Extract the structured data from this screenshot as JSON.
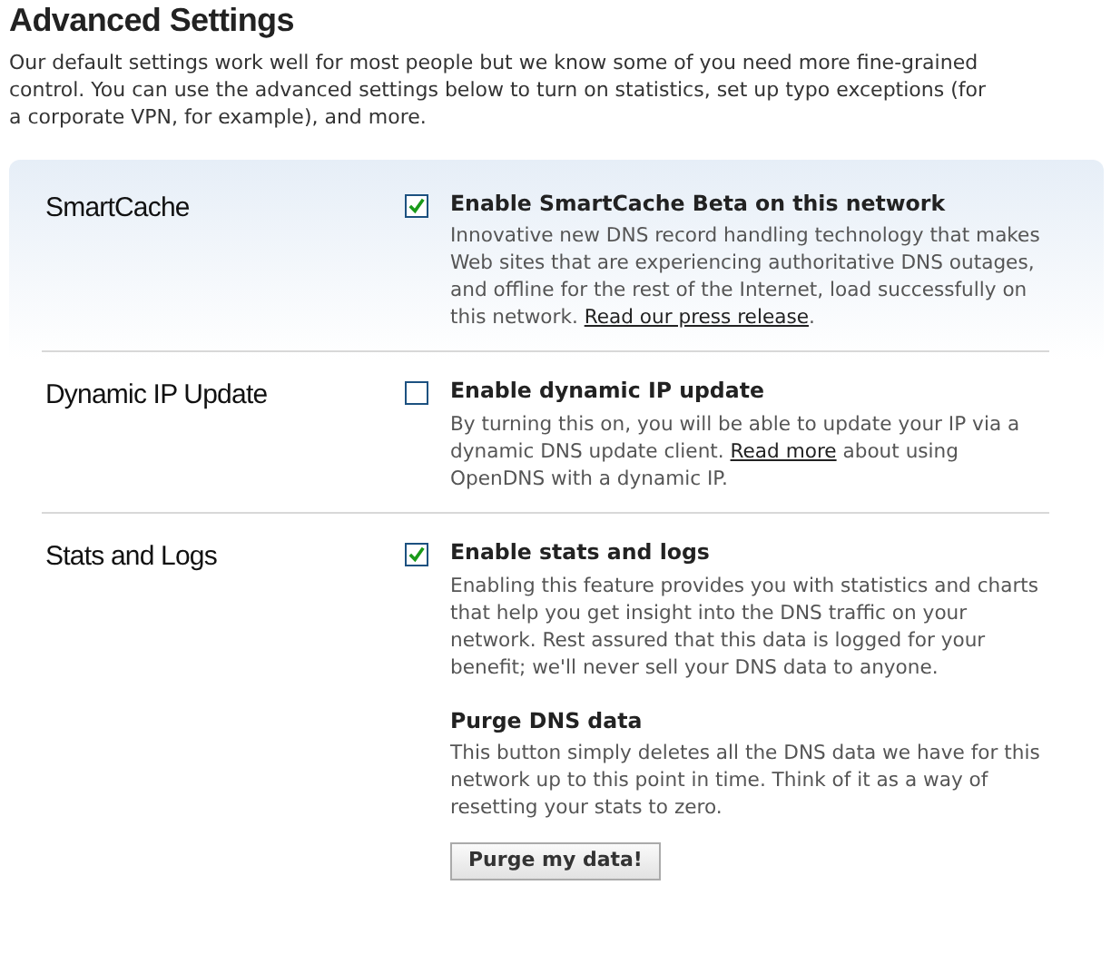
{
  "title": "Advanced Settings",
  "intro": "Our default settings work well for most people but we know some of you need more fine-grained control. You can use the advanced settings below to turn on statistics, set up typo exceptions (for a corporate VPN, for example), and more.",
  "sections": [
    {
      "label": "SmartCache",
      "items": [
        {
          "kind": "checkbox",
          "title": "Enable SmartCache Beta on this network",
          "checked": true,
          "description": [
            {
              "kind": "text",
              "text": "Innovative new DNS record handling technology that makes Web sites that are experiencing authoritative DNS outages, and offline for the rest of the Internet, load successfully on this network. "
            },
            {
              "kind": "link",
              "text": "Read our press release"
            },
            {
              "kind": "text",
              "text": "."
            }
          ]
        }
      ]
    },
    {
      "label": "Dynamic IP Update",
      "items": [
        {
          "kind": "checkbox",
          "title": "Enable dynamic IP update",
          "checked": false,
          "description": [
            {
              "kind": "text",
              "text": "By turning this on, you will be able to update your IP via a dynamic DNS update client. "
            },
            {
              "kind": "link",
              "text": "Read more"
            },
            {
              "kind": "text",
              "text": " about using OpenDNS with a dynamic IP."
            }
          ]
        }
      ]
    },
    {
      "label": "Stats and Logs",
      "items": [
        {
          "kind": "checkbox",
          "title": "Enable stats and logs",
          "checked": true,
          "description": [
            {
              "kind": "text",
              "text": "Enabling this feature provides you with statistics and charts that help you get insight into the DNS traffic on your network. Rest assured that this data is logged for your benefit; we'll never sell your DNS data to anyone."
            }
          ]
        },
        {
          "kind": "action",
          "title": "Purge DNS data",
          "description": [
            {
              "kind": "text",
              "text": "This button simply deletes all the DNS data we have for this network up to this point in time. Think of it as a way of resetting your stats to zero."
            }
          ],
          "button": "Purge my data!"
        }
      ]
    }
  ]
}
